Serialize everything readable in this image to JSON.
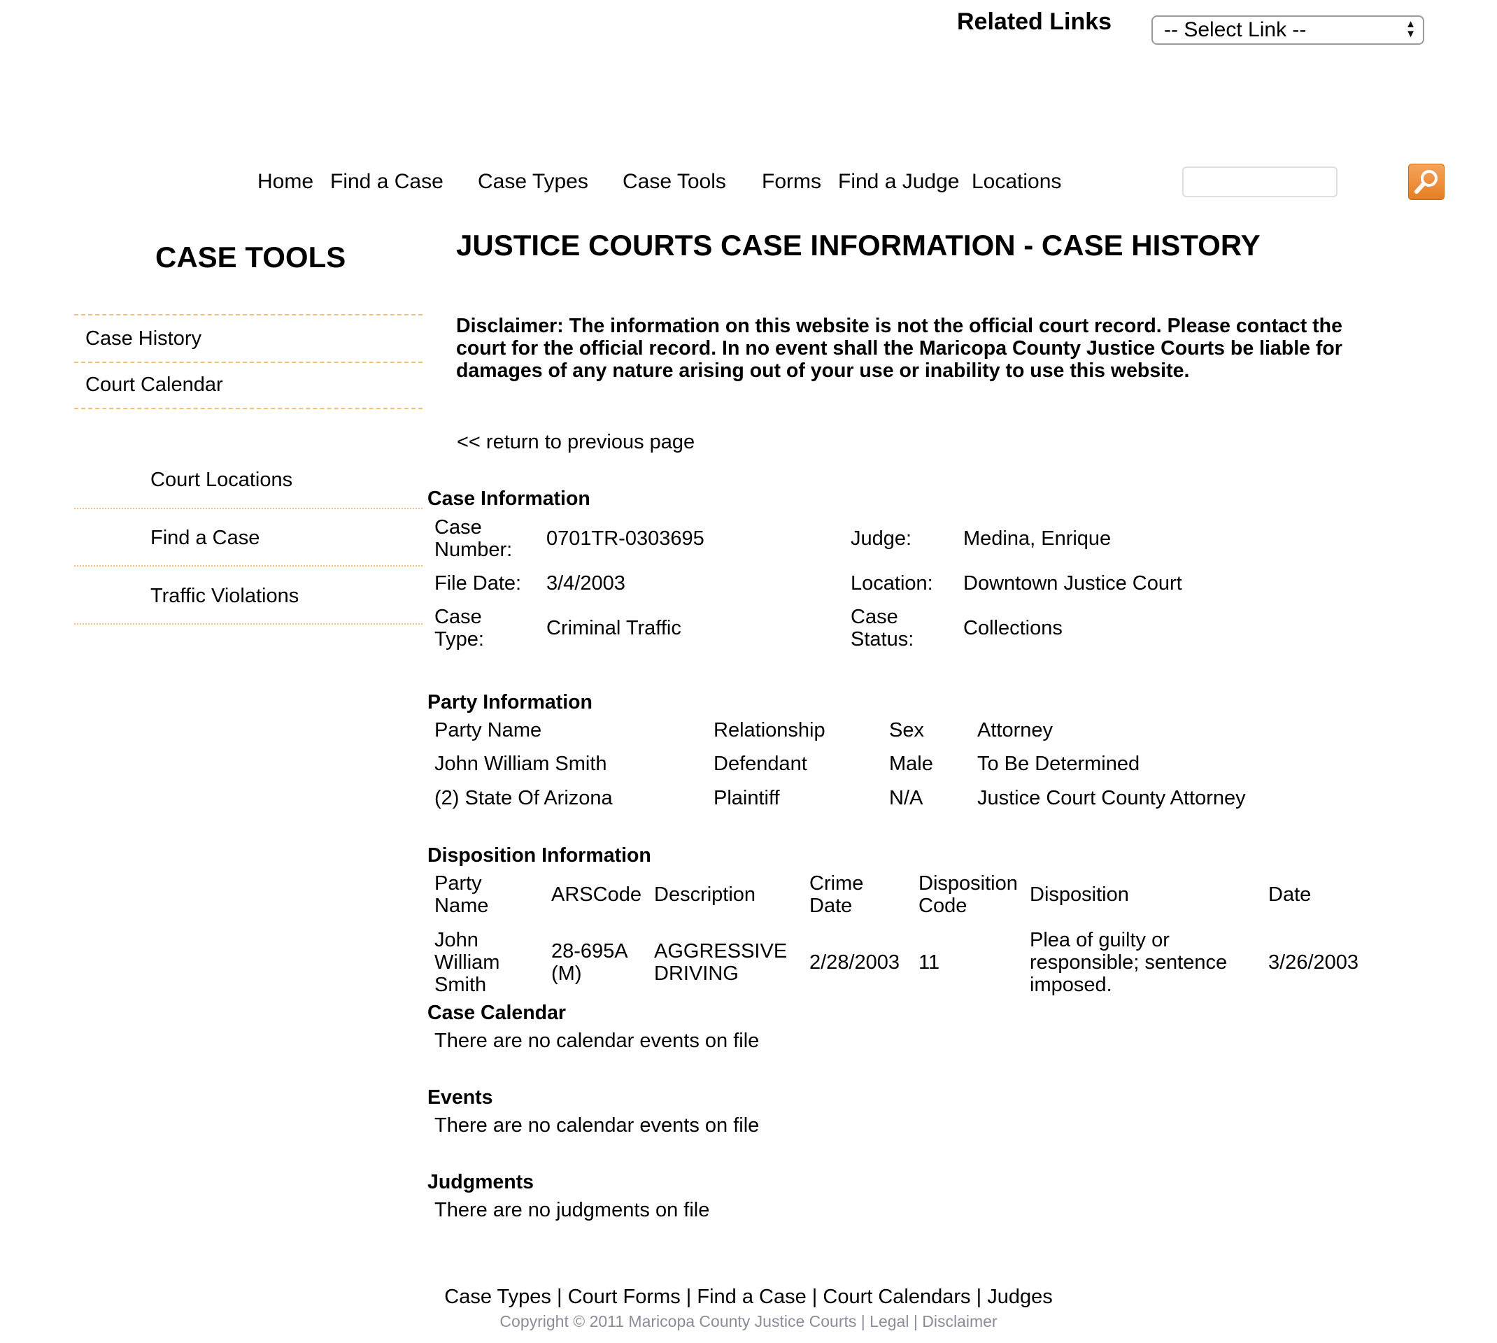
{
  "header": {
    "related_links_label": "Related Links",
    "select_value": "-- Select Link --"
  },
  "nav": {
    "items": [
      "Home",
      "Find a Case",
      "Case Types",
      "Case Tools",
      "Forms",
      "Find a Judge",
      "Locations"
    ],
    "search_placeholder": ""
  },
  "sidebar": {
    "title": "CASE TOOLS",
    "primary_items": [
      "Case History",
      "Court Calendar"
    ],
    "secondary_items": [
      "Court Locations",
      "Find a Case",
      "Traffic Violations"
    ]
  },
  "main": {
    "title": "JUSTICE COURTS CASE INFORMATION - CASE HISTORY",
    "disclaimer": "Disclaimer: The information on this website is not the official court record. Please contact the court for the official record. In no event shall the Maricopa County Justice Courts be liable for damages of any nature arising out of your use or inability to use this website.",
    "return_link": "<< return to previous page",
    "case_info": {
      "title": "Case Information",
      "case_number_label_1": "Case",
      "case_number_label_2": "Number:",
      "case_number": "0701TR-0303695",
      "judge_label": "Judge:",
      "judge": "Medina, Enrique",
      "file_date_label": "File Date:",
      "file_date": "3/4/2003",
      "location_label": "Location:",
      "location": "Downtown Justice Court",
      "case_type_label_1": "Case",
      "case_type_label_2": "Type:",
      "case_type": "Criminal Traffic",
      "case_status_label_1": "Case",
      "case_status_label_2": "Status:",
      "case_status": "Collections"
    },
    "party_info": {
      "title": "Party Information",
      "headers": [
        "Party Name",
        "Relationship",
        "Sex",
        "Attorney"
      ],
      "rows": [
        [
          "John William Smith",
          "Defendant",
          "Male",
          "To Be Determined"
        ],
        [
          "(2) State Of Arizona",
          "Plaintiff",
          "N/A",
          "Justice Court County Attorney"
        ]
      ]
    },
    "disposition_info": {
      "title": "Disposition Information",
      "headers": {
        "party_name_1": "Party",
        "party_name_2": "Name",
        "ars_code": "ARSCode",
        "description": "Description",
        "crime_date_1": "Crime",
        "crime_date_2": "Date",
        "disp_code_1": "Disposition",
        "disp_code_2": "Code",
        "disposition": "Disposition",
        "date": "Date"
      },
      "row": {
        "party_1": "John",
        "party_2": "William",
        "party_3": "Smith",
        "ars_1": "28-695A",
        "ars_2": "(M)",
        "desc_1": "AGGRESSIVE",
        "desc_2": "DRIVING",
        "crime_date": "2/28/2003",
        "disp_code": "11",
        "disp_1": "Plea of guilty or",
        "disp_2": "responsible; sentence",
        "disp_3": "imposed.",
        "date": "3/26/2003"
      }
    },
    "case_calendar": {
      "title": "Case Calendar",
      "text": "There are no calendar events on file"
    },
    "events": {
      "title": "Events",
      "text": "There are no calendar events on file"
    },
    "judgments": {
      "title": "Judgments",
      "text": "There are no judgments on file"
    }
  },
  "footer": {
    "links": [
      "Case Types",
      "Court Forms",
      "Find a Case",
      "Court Calendars",
      "Judges"
    ],
    "separator": " | ",
    "copyright": "Copyright © 2011 Maricopa County Justice Courts",
    "legal": "Legal",
    "disclaimer": "Disclaimer"
  },
  "colors": {
    "sidebar_line": "#f2c078",
    "search_button": "#e67e22",
    "copyright_text": "#8a8d99"
  },
  "icons": {
    "search_button": "magnifier-icon",
    "select_arrows": "up-down-arrows-icon"
  }
}
